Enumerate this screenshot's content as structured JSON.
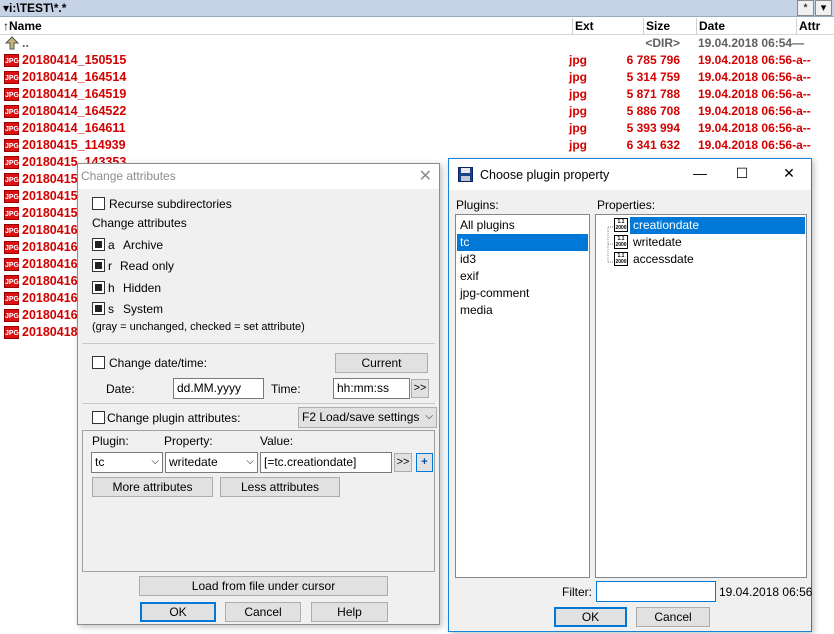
{
  "panel": {
    "path": "▾i:\\TEST\\*.*",
    "path_buttons": [
      "*",
      "▾"
    ],
    "columns": {
      "name": "↑Name",
      "ext": "Ext",
      "size": "Size",
      "date": "Date",
      "attr": "Attr"
    },
    "up_row": {
      "name": "..",
      "size": "<DIR>",
      "date": "19.04.2018 06:54—"
    },
    "file_icon_label": "JPG",
    "files": [
      {
        "name": "20180414_150515",
        "ext": "jpg",
        "size": "6 785 796",
        "date": "19.04.2018 06:56-a--"
      },
      {
        "name": "20180414_164514",
        "ext": "jpg",
        "size": "5 314 759",
        "date": "19.04.2018 06:56-a--"
      },
      {
        "name": "20180414_164519",
        "ext": "jpg",
        "size": "5 871 788",
        "date": "19.04.2018 06:56-a--"
      },
      {
        "name": "20180414_164522",
        "ext": "jpg",
        "size": "5 886 708",
        "date": "19.04.2018 06:56-a--"
      },
      {
        "name": "20180414_164611",
        "ext": "jpg",
        "size": "5 393 994",
        "date": "19.04.2018 06:56-a--"
      },
      {
        "name": "20180415_114939",
        "ext": "jpg",
        "size": "6 341 632",
        "date": "19.04.2018 06:56-a--"
      },
      {
        "name": "20180415_143353",
        "ext": "",
        "size": "",
        "date": ""
      },
      {
        "name": "20180415",
        "ext": "",
        "size": "",
        "date": ""
      },
      {
        "name": "20180415",
        "ext": "",
        "size": "",
        "date": ""
      },
      {
        "name": "20180415",
        "ext": "",
        "size": "",
        "date": ""
      },
      {
        "name": "20180416",
        "ext": "",
        "size": "",
        "date": ""
      },
      {
        "name": "20180416",
        "ext": "",
        "size": "",
        "date": ""
      },
      {
        "name": "20180416",
        "ext": "",
        "size": "",
        "date": ""
      },
      {
        "name": "20180416",
        "ext": "",
        "size": "",
        "date": ""
      },
      {
        "name": "20180416",
        "ext": "",
        "size": "",
        "date": ""
      },
      {
        "name": "20180416",
        "ext": "",
        "size": "",
        "date": ""
      },
      {
        "name": "20180418",
        "ext": "",
        "size": "",
        "date": ""
      }
    ]
  },
  "attr_dialog": {
    "title": "Change attributes",
    "close_glyph": "✕",
    "recurse": "Recurse subdirectories",
    "change_attributes": "Change attributes",
    "attributes": [
      {
        "key": "a",
        "label": "Archive"
      },
      {
        "key": "r",
        "label": "Read only"
      },
      {
        "key": "h",
        "label": "Hidden"
      },
      {
        "key": "s",
        "label": "System"
      }
    ],
    "note": "(gray = unchanged, checked = set attribute)",
    "change_datetime": "Change date/time:",
    "current_button": "Current",
    "date_label": "Date:",
    "date_value": "dd.MM.yyyy",
    "time_label": "Time:",
    "time_value": "hh:mm:ss",
    "time_more": ">>",
    "change_plugin": "Change plugin attributes:",
    "load_save": "F2 Load/save settings",
    "plugin_label": "Plugin:",
    "property_label": "Property:",
    "value_label": "Value:",
    "plugin_value": "tc",
    "property_value": "writedate",
    "value_value": "[=tc.creationdate]",
    "value_more": ">>",
    "value_plus": "+",
    "more_attributes": "More attributes",
    "less_attributes": "Less attributes",
    "load_from_file": "Load from file under cursor",
    "ok": "OK",
    "cancel": "Cancel",
    "help": "Help"
  },
  "plugin_dialog": {
    "title": "Choose plugin property",
    "window_buttons": [
      "—",
      "☐",
      "✕"
    ],
    "plugins_label": "Plugins:",
    "properties_label": "Properties:",
    "plugins": [
      "All plugins",
      "tc",
      "id3",
      "exif",
      "jpg-comment",
      "media"
    ],
    "selected_plugin": "tc",
    "tree_icon_label": "1.1 2000",
    "properties": [
      "creationdate",
      "writedate",
      "accessdate"
    ],
    "selected_property": "creationdate",
    "filter_label": "Filter:",
    "filter_value": "",
    "filter_preview": "19.04.2018 06:56",
    "ok": "OK",
    "cancel": "Cancel"
  }
}
